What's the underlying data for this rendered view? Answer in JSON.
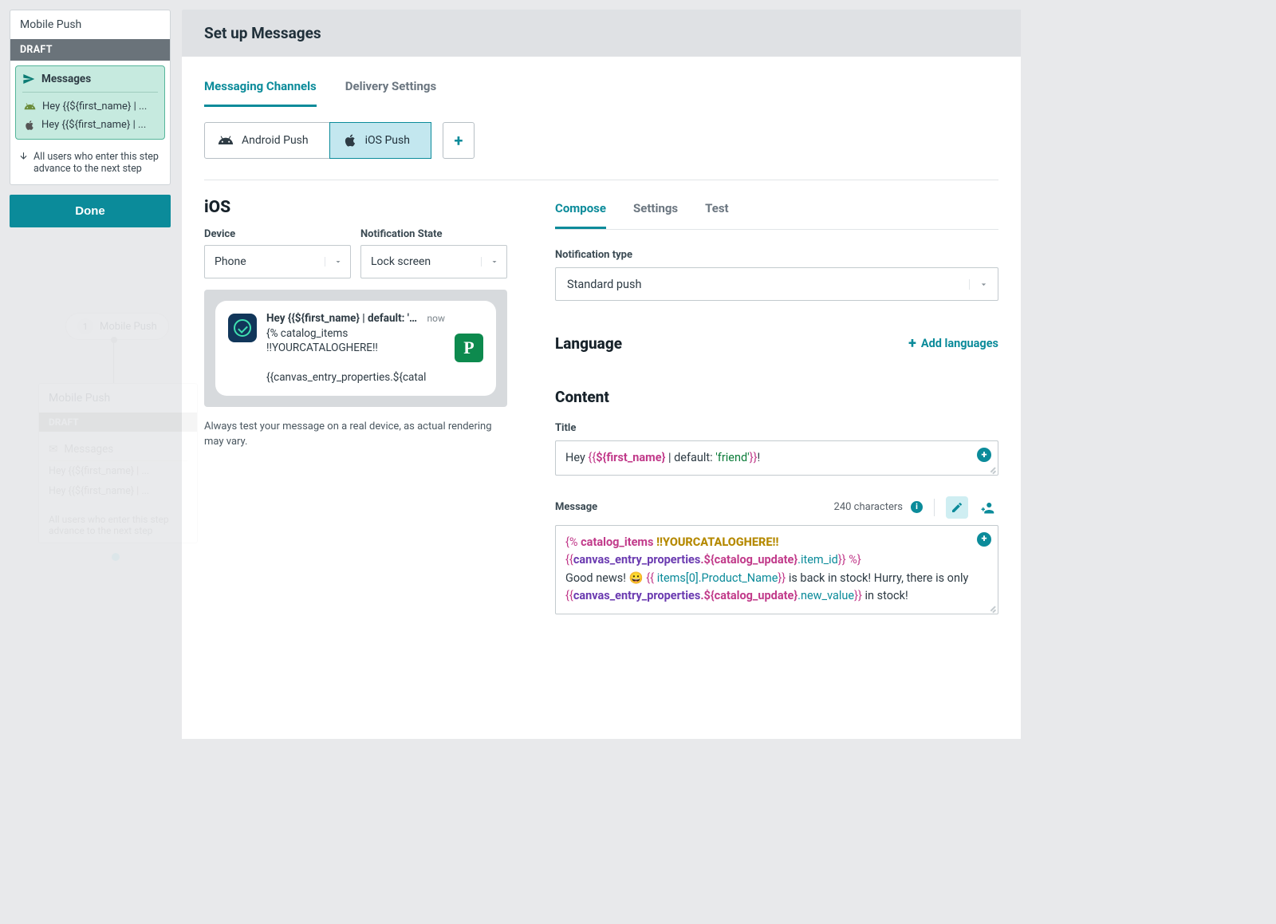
{
  "sidebar": {
    "title": "Mobile Push",
    "draft_label": "DRAFT",
    "messages_label": "Messages",
    "rows": [
      {
        "text": "Hey {{${first_name} | ..."
      },
      {
        "text": "Hey {{${first_name} | ..."
      }
    ],
    "advance_text": "All users who enter this step advance to the next step",
    "done_label": "Done"
  },
  "ghost": {
    "pill_num": "1",
    "pill_label": "Mobile Push",
    "card_title": "Mobile Push",
    "draft": "DRAFT",
    "messages": "Messages",
    "row1": "Hey {{${first_name} | ...",
    "row2": "Hey {{${first_name} | ...",
    "adv": "All users who enter this step advance to the next step"
  },
  "header": {
    "title": "Set up Messages"
  },
  "tabs_primary": {
    "channels": "Messaging Channels",
    "delivery": "Delivery Settings"
  },
  "channels": {
    "android": "Android Push",
    "ios": "iOS Push"
  },
  "ios": {
    "heading": "iOS",
    "device_label": "Device",
    "device_value": "Phone",
    "state_label": "Notification State",
    "state_value": "Lock screen",
    "preview_title": "Hey {{${first_name} | default: 'frien...",
    "preview_now": "now",
    "preview_body_l1": "{% catalog_items !!YOURCATALOGHERE!!",
    "preview_body_l2": "{{canvas_entry_properties.${catal",
    "p_badge": "P",
    "disclaimer": "Always test your message on a real device, as actual rendering may vary."
  },
  "compose_tabs": {
    "compose": "Compose",
    "settings": "Settings",
    "test": "Test"
  },
  "notification_type": {
    "label": "Notification type",
    "value": "Standard push"
  },
  "language": {
    "heading": "Language",
    "add": "Add languages"
  },
  "content": {
    "heading": "Content",
    "title_label": "Title",
    "title_prefix": "Hey ",
    "title_tpl_open": "{{",
    "title_var": "${first_name}",
    "title_mid": " | default: ",
    "title_str": "'friend'",
    "title_tpl_close": "}}",
    "title_suffix": "!",
    "message_label": "Message",
    "char_count": "240 characters",
    "msg": {
      "l1_open": "{% ",
      "l1_tag": "catalog_items ",
      "l1_cat": "!!YOURCATALOGHERE!!",
      "l2_open": "{{",
      "l2_a": "canvas_entry_properties",
      "l2_dot1": ".",
      "l2_b": "${catalog_update}",
      "l2_dot2": ".",
      "l2_c": "item_id",
      "l2_close": "}}",
      "l2_pctclose": " %}",
      "l3_a": "Good news! 😀 ",
      "l3_open": "{{ ",
      "l3_b": "items[0]",
      "l3_dot": ".",
      "l3_c": "Product_Name",
      "l3_close": "}}",
      "l3_d": " is back in stock! Hurry, there is only ",
      "l4_open": "{{",
      "l4_a": "canvas_entry_properties",
      "l4_dot1": ".",
      "l4_b": "${catalog_update}",
      "l4_dot2": ".",
      "l4_c": "new_value",
      "l4_close": "}}",
      "l4_d": " in stock!"
    }
  }
}
